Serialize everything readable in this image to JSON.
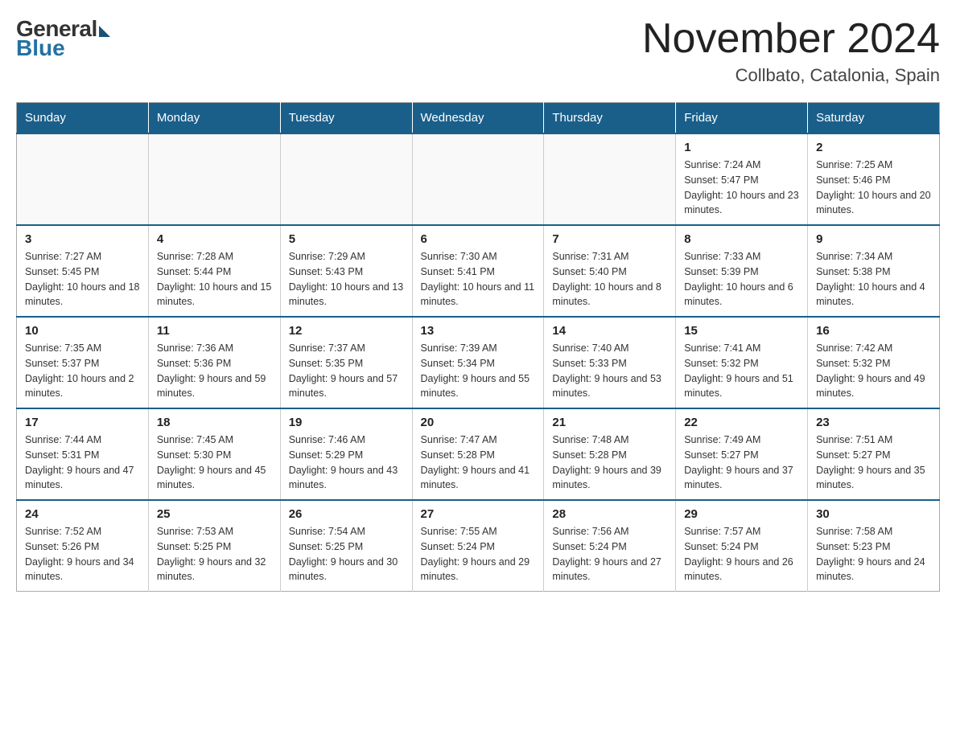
{
  "logo": {
    "general": "General",
    "blue": "Blue"
  },
  "title": "November 2024",
  "location": "Collbato, Catalonia, Spain",
  "days_of_week": [
    "Sunday",
    "Monday",
    "Tuesday",
    "Wednesday",
    "Thursday",
    "Friday",
    "Saturday"
  ],
  "weeks": [
    [
      {
        "day": "",
        "info": ""
      },
      {
        "day": "",
        "info": ""
      },
      {
        "day": "",
        "info": ""
      },
      {
        "day": "",
        "info": ""
      },
      {
        "day": "",
        "info": ""
      },
      {
        "day": "1",
        "info": "Sunrise: 7:24 AM\nSunset: 5:47 PM\nDaylight: 10 hours and 23 minutes."
      },
      {
        "day": "2",
        "info": "Sunrise: 7:25 AM\nSunset: 5:46 PM\nDaylight: 10 hours and 20 minutes."
      }
    ],
    [
      {
        "day": "3",
        "info": "Sunrise: 7:27 AM\nSunset: 5:45 PM\nDaylight: 10 hours and 18 minutes."
      },
      {
        "day": "4",
        "info": "Sunrise: 7:28 AM\nSunset: 5:44 PM\nDaylight: 10 hours and 15 minutes."
      },
      {
        "day": "5",
        "info": "Sunrise: 7:29 AM\nSunset: 5:43 PM\nDaylight: 10 hours and 13 minutes."
      },
      {
        "day": "6",
        "info": "Sunrise: 7:30 AM\nSunset: 5:41 PM\nDaylight: 10 hours and 11 minutes."
      },
      {
        "day": "7",
        "info": "Sunrise: 7:31 AM\nSunset: 5:40 PM\nDaylight: 10 hours and 8 minutes."
      },
      {
        "day": "8",
        "info": "Sunrise: 7:33 AM\nSunset: 5:39 PM\nDaylight: 10 hours and 6 minutes."
      },
      {
        "day": "9",
        "info": "Sunrise: 7:34 AM\nSunset: 5:38 PM\nDaylight: 10 hours and 4 minutes."
      }
    ],
    [
      {
        "day": "10",
        "info": "Sunrise: 7:35 AM\nSunset: 5:37 PM\nDaylight: 10 hours and 2 minutes."
      },
      {
        "day": "11",
        "info": "Sunrise: 7:36 AM\nSunset: 5:36 PM\nDaylight: 9 hours and 59 minutes."
      },
      {
        "day": "12",
        "info": "Sunrise: 7:37 AM\nSunset: 5:35 PM\nDaylight: 9 hours and 57 minutes."
      },
      {
        "day": "13",
        "info": "Sunrise: 7:39 AM\nSunset: 5:34 PM\nDaylight: 9 hours and 55 minutes."
      },
      {
        "day": "14",
        "info": "Sunrise: 7:40 AM\nSunset: 5:33 PM\nDaylight: 9 hours and 53 minutes."
      },
      {
        "day": "15",
        "info": "Sunrise: 7:41 AM\nSunset: 5:32 PM\nDaylight: 9 hours and 51 minutes."
      },
      {
        "day": "16",
        "info": "Sunrise: 7:42 AM\nSunset: 5:32 PM\nDaylight: 9 hours and 49 minutes."
      }
    ],
    [
      {
        "day": "17",
        "info": "Sunrise: 7:44 AM\nSunset: 5:31 PM\nDaylight: 9 hours and 47 minutes."
      },
      {
        "day": "18",
        "info": "Sunrise: 7:45 AM\nSunset: 5:30 PM\nDaylight: 9 hours and 45 minutes."
      },
      {
        "day": "19",
        "info": "Sunrise: 7:46 AM\nSunset: 5:29 PM\nDaylight: 9 hours and 43 minutes."
      },
      {
        "day": "20",
        "info": "Sunrise: 7:47 AM\nSunset: 5:28 PM\nDaylight: 9 hours and 41 minutes."
      },
      {
        "day": "21",
        "info": "Sunrise: 7:48 AM\nSunset: 5:28 PM\nDaylight: 9 hours and 39 minutes."
      },
      {
        "day": "22",
        "info": "Sunrise: 7:49 AM\nSunset: 5:27 PM\nDaylight: 9 hours and 37 minutes."
      },
      {
        "day": "23",
        "info": "Sunrise: 7:51 AM\nSunset: 5:27 PM\nDaylight: 9 hours and 35 minutes."
      }
    ],
    [
      {
        "day": "24",
        "info": "Sunrise: 7:52 AM\nSunset: 5:26 PM\nDaylight: 9 hours and 34 minutes."
      },
      {
        "day": "25",
        "info": "Sunrise: 7:53 AM\nSunset: 5:25 PM\nDaylight: 9 hours and 32 minutes."
      },
      {
        "day": "26",
        "info": "Sunrise: 7:54 AM\nSunset: 5:25 PM\nDaylight: 9 hours and 30 minutes."
      },
      {
        "day": "27",
        "info": "Sunrise: 7:55 AM\nSunset: 5:24 PM\nDaylight: 9 hours and 29 minutes."
      },
      {
        "day": "28",
        "info": "Sunrise: 7:56 AM\nSunset: 5:24 PM\nDaylight: 9 hours and 27 minutes."
      },
      {
        "day": "29",
        "info": "Sunrise: 7:57 AM\nSunset: 5:24 PM\nDaylight: 9 hours and 26 minutes."
      },
      {
        "day": "30",
        "info": "Sunrise: 7:58 AM\nSunset: 5:23 PM\nDaylight: 9 hours and 24 minutes."
      }
    ]
  ]
}
